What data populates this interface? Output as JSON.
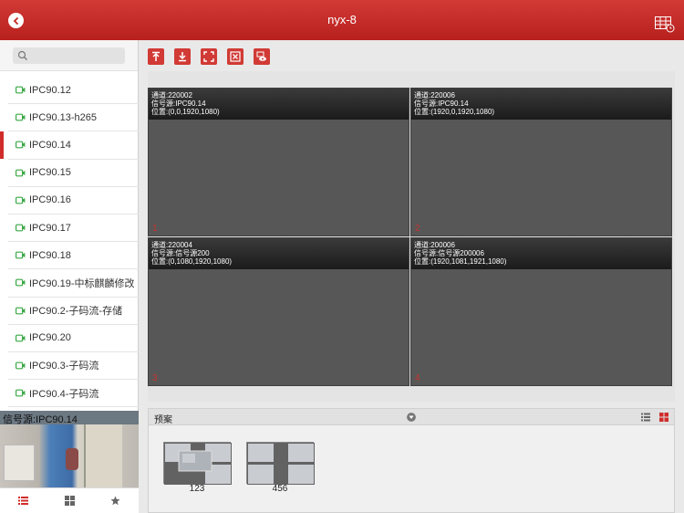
{
  "header": {
    "title": "nyx-8"
  },
  "search": {
    "placeholder": ""
  },
  "devices": [
    {
      "label": "IPC90.12",
      "selected": false
    },
    {
      "label": "IPC90.13-h265",
      "selected": false
    },
    {
      "label": "IPC90.14",
      "selected": true
    },
    {
      "label": "IPC90.15",
      "selected": false
    },
    {
      "label": "IPC90.16",
      "selected": false
    },
    {
      "label": "IPC90.17",
      "selected": false
    },
    {
      "label": "IPC90.18",
      "selected": false
    },
    {
      "label": "IPC90.19-中标麒麟修改",
      "selected": false
    },
    {
      "label": "IPC90.2-子码流-存储",
      "selected": false
    },
    {
      "label": "IPC90.20",
      "selected": false
    },
    {
      "label": "IPC90.3-子码流",
      "selected": false
    },
    {
      "label": "IPC90.4-子码流",
      "selected": false
    }
  ],
  "preview": {
    "label": "信号源:IPC90.14"
  },
  "screens": [
    {
      "channel": "通道:220002",
      "source": "信号源:IPC90.14",
      "position": "位置:(0,0,1920,1080)",
      "number": "1"
    },
    {
      "channel": "通道:220006",
      "source": "信号源:IPC90.14",
      "position": "位置:(1920,0,1920,1080)",
      "number": "2"
    },
    {
      "channel": "通道:220004",
      "source": "信号源:信号源200",
      "position": "位置:(0,1080,1920,1080)",
      "number": "3"
    },
    {
      "channel": "通道:200006",
      "source": "信号源:信号源200006",
      "position": "位置:(1920,1081,1921,1080)",
      "number": "4"
    }
  ],
  "presets": {
    "title": "预案",
    "items": [
      {
        "label": "123"
      },
      {
        "label": "456"
      }
    ]
  },
  "colors": {
    "accent": "#d02d2a",
    "device_icon": "#3aa845"
  },
  "icons": {
    "back": "back-arrow-icon",
    "layout": "wall-layout-icon",
    "toolbar": [
      "upload-icon",
      "download-icon",
      "fullscreen-icon",
      "close-screen-icon",
      "monitor-eye-icon"
    ],
    "tabs": [
      "list-icon",
      "grid-icon",
      "star-icon"
    ]
  }
}
